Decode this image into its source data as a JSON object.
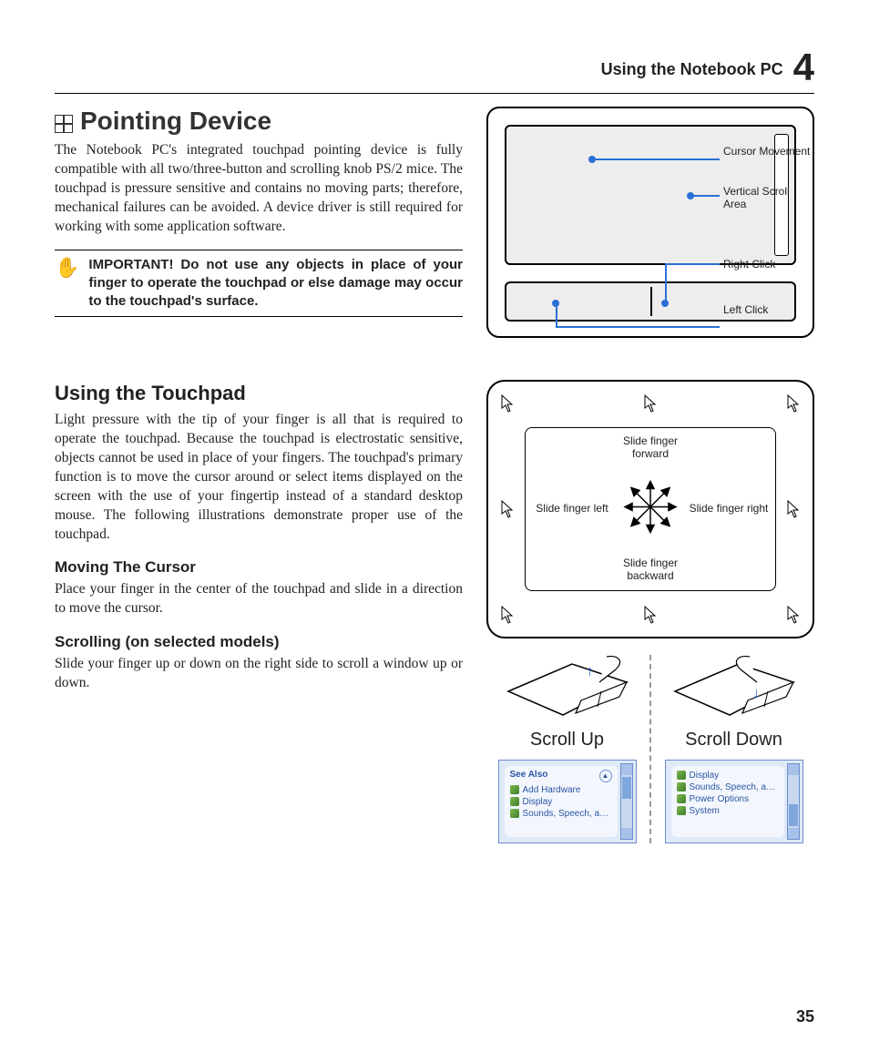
{
  "header": {
    "section": "Using the Notebook PC",
    "chapter": "4"
  },
  "title": "Pointing Device",
  "intro": "The Notebook PC's integrated touchpad pointing device is fully compatible with all two/three-button and scrolling knob PS/2 mice. The touchpad is pressure sensitive and contains no moving parts; therefore, mechanical failures can be avoided. A device driver is still required for working with some application software.",
  "important": "IMPORTANT! Do not use any objects in place of your finger to operate the touchpad or else damage may occur to the touchpad's surface.",
  "touchpad_labels": {
    "cursor": "Cursor Movement",
    "vscroll": "Vertical Scroll Area",
    "rclick": "Right Click",
    "lclick": "Left Click"
  },
  "using_heading": "Using the Touchpad",
  "using_body": "Light pressure with the tip of your finger is all that is required to operate the touchpad. Because the touchpad is electrostatic sensitive, objects cannot be used in place of your fingers. The touchpad's primary function is to move the cursor around or select items displayed on the screen with the use of your fingertip instead of a standard desktop mouse. The following illustrations demonstrate proper use of the touchpad.",
  "moving_heading": "Moving The Cursor",
  "moving_body": "Place your finger in the center of the touchpad and slide in a direction to move the cursor.",
  "scrolling_heading": "Scrolling (on selected models)",
  "scrolling_body": "Slide your finger up or down on the right side to scroll a window up or down.",
  "dir": {
    "forward": "Slide finger forward",
    "back": "Slide finger backward",
    "left": "Slide finger left",
    "right": "Slide finger right"
  },
  "scroll": {
    "up": "Scroll Up",
    "down": "Scroll Down"
  },
  "xp_left": {
    "header": "See Also",
    "items": [
      "Add Hardware",
      "Display",
      "Sounds, Speech, and Audio Devices"
    ]
  },
  "xp_right": {
    "items": [
      "Display",
      "Sounds, Speech, and Audio Devices",
      "Power Options",
      "System"
    ]
  },
  "page_number": "35"
}
